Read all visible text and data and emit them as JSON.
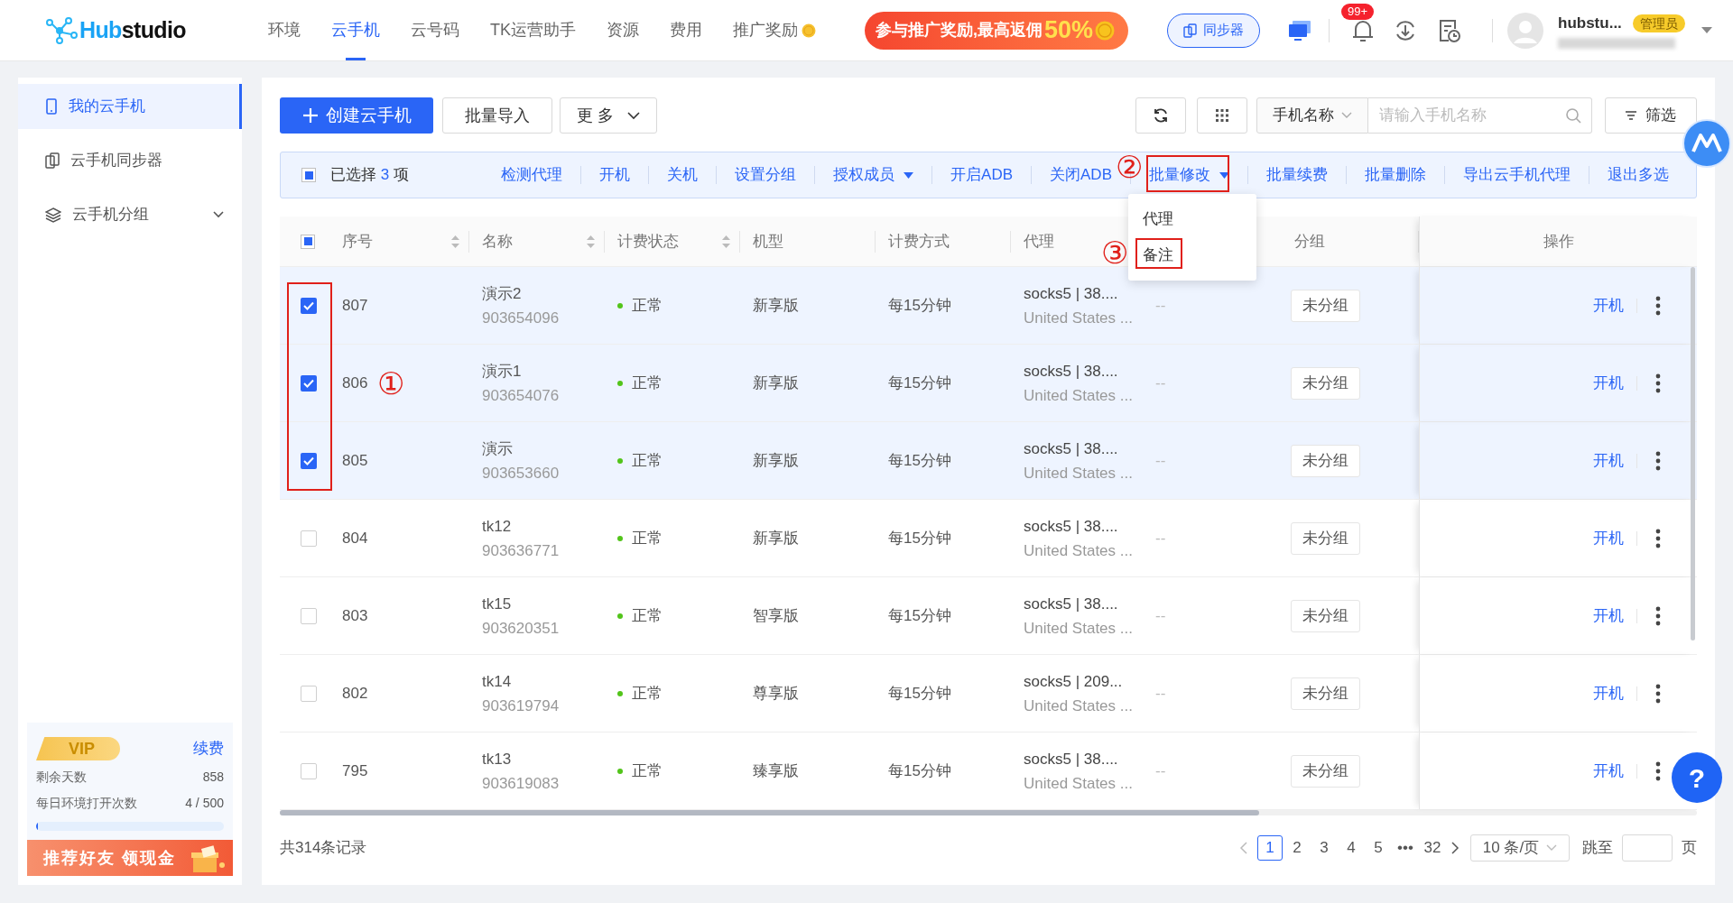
{
  "header": {
    "logo_primary": "Hub",
    "logo_secondary": "studio",
    "nav": [
      {
        "label": "环境",
        "selected": false
      },
      {
        "label": "云手机",
        "selected": true
      },
      {
        "label": "云号码",
        "selected": false
      },
      {
        "label": "TK运营助手",
        "selected": false
      },
      {
        "label": "资源",
        "selected": false
      },
      {
        "label": "费用",
        "selected": false
      },
      {
        "label": "推广奖励",
        "selected": false
      }
    ],
    "promo": {
      "text": "参与推广奖励,最高返佣",
      "highlight": "50%"
    },
    "sync_button": "同步器",
    "notification_badge": "99+",
    "user": {
      "name": "hubstu...",
      "role": "管理员"
    }
  },
  "sidebar": {
    "items": [
      {
        "label": "我的云手机",
        "selected": true,
        "kind": "phone"
      },
      {
        "label": "云手机同步器",
        "selected": false,
        "kind": "sync"
      },
      {
        "label": "云手机分组",
        "selected": false,
        "kind": "group"
      }
    ],
    "vip": {
      "badge": "VIP",
      "renew": "续费",
      "stats": [
        {
          "label": "剩余天数",
          "value": "858"
        },
        {
          "label": "每日环境打开次数",
          "value": "4 / 500"
        }
      ],
      "level": 0.01,
      "banner": "推荐好友 领现金"
    }
  },
  "toolbar": {
    "create": "创建云手机",
    "import": "批量导入",
    "more": "更 多",
    "field_select": "手机名称",
    "search_placeholder": "请输入手机名称",
    "filter": "筛选"
  },
  "selection_bar": {
    "indeterminate": true,
    "prefix": "已选择",
    "count": "3",
    "suffix": "项",
    "actions": [
      {
        "label": "检测代理",
        "dropdown": false
      },
      {
        "label": "开机",
        "dropdown": false
      },
      {
        "label": "关机",
        "dropdown": false
      },
      {
        "label": "设置分组",
        "dropdown": false
      },
      {
        "label": "授权成员",
        "dropdown": true
      },
      {
        "label": "开启ADB",
        "dropdown": false
      },
      {
        "label": "关闭ADB",
        "dropdown": false
      },
      {
        "label": "批量修改",
        "dropdown": true
      },
      {
        "label": "批量续费",
        "dropdown": false
      },
      {
        "label": "批量删除",
        "dropdown": false
      },
      {
        "label": "导出云手机代理",
        "dropdown": false
      },
      {
        "label": "退出多选",
        "dropdown": false
      }
    ]
  },
  "menu": {
    "items": [
      "代理",
      "备注"
    ]
  },
  "table": {
    "header_checkbox": {
      "indeterminate": true
    },
    "columns": [
      {
        "label": "序号",
        "sortable": true
      },
      {
        "label": "名称",
        "sortable": true
      },
      {
        "label": "计费状态",
        "sortable": true
      },
      {
        "label": "机型",
        "sortable": false
      },
      {
        "label": "计费方式",
        "sortable": false
      },
      {
        "label": "代理",
        "sortable": false
      },
      {
        "label": "分组",
        "sortable": false
      },
      {
        "label": "操作",
        "sortable": false
      }
    ],
    "rows": [
      {
        "selected": true,
        "number": "807",
        "name": "演示2",
        "phone_id": "903654096",
        "status": "正常",
        "model": "新享版",
        "billing": "每15分钟",
        "proxy": "socks5 | 38....",
        "proxy_location": "United States ...",
        "column_8": "--",
        "group": "未分组",
        "action": "开机"
      },
      {
        "selected": true,
        "number": "806",
        "name": "演示1",
        "phone_id": "903654076",
        "status": "正常",
        "model": "新享版",
        "billing": "每15分钟",
        "proxy": "socks5 | 38....",
        "proxy_location": "United States ...",
        "column_8": "--",
        "group": "未分组",
        "action": "开机"
      },
      {
        "selected": true,
        "number": "805",
        "name": "演示",
        "phone_id": "903653660",
        "status": "正常",
        "model": "新享版",
        "billing": "每15分钟",
        "proxy": "socks5 | 38....",
        "proxy_location": "United States ...",
        "column_8": "--",
        "group": "未分组",
        "action": "开机"
      },
      {
        "selected": false,
        "number": "804",
        "name": "tk12",
        "phone_id": "903636771",
        "status": "正常",
        "model": "新享版",
        "billing": "每15分钟",
        "proxy": "socks5 | 38....",
        "proxy_location": "United States ...",
        "column_8": "--",
        "group": "未分组",
        "action": "开机"
      },
      {
        "selected": false,
        "number": "803",
        "name": "tk15",
        "phone_id": "903620351",
        "status": "正常",
        "model": "智享版",
        "billing": "每15分钟",
        "proxy": "socks5 | 38....",
        "proxy_location": "United States ...",
        "column_8": "--",
        "group": "未分组",
        "action": "开机"
      },
      {
        "selected": false,
        "number": "802",
        "name": "tk14",
        "phone_id": "903619794",
        "status": "正常",
        "model": "尊享版",
        "billing": "每15分钟",
        "proxy": "socks5 | 209...",
        "proxy_location": "United States ...",
        "column_8": "--",
        "group": "未分组",
        "action": "开机"
      },
      {
        "selected": false,
        "number": "795",
        "name": "tk13",
        "phone_id": "903619083",
        "status": "正常",
        "model": "臻享版",
        "billing": "每15分钟",
        "proxy": "socks5 | 38....",
        "proxy_location": "United States ...",
        "column_8": "--",
        "group": "未分组",
        "action": "开机"
      }
    ]
  },
  "pagination": {
    "total": "共314条记录",
    "pages": [
      {
        "label": "1",
        "selected": true
      },
      {
        "label": "2",
        "selected": false
      },
      {
        "label": "3",
        "selected": false
      },
      {
        "label": "4",
        "selected": false
      },
      {
        "label": "5",
        "selected": false
      },
      {
        "label": "•••",
        "selected": false
      },
      {
        "label": "32",
        "selected": false
      }
    ],
    "page_size": "10 条/页",
    "jump_label": "跳至",
    "page_suffix": "页"
  },
  "annotations": [
    "①",
    "②",
    "③"
  ],
  "help_button": "?"
}
